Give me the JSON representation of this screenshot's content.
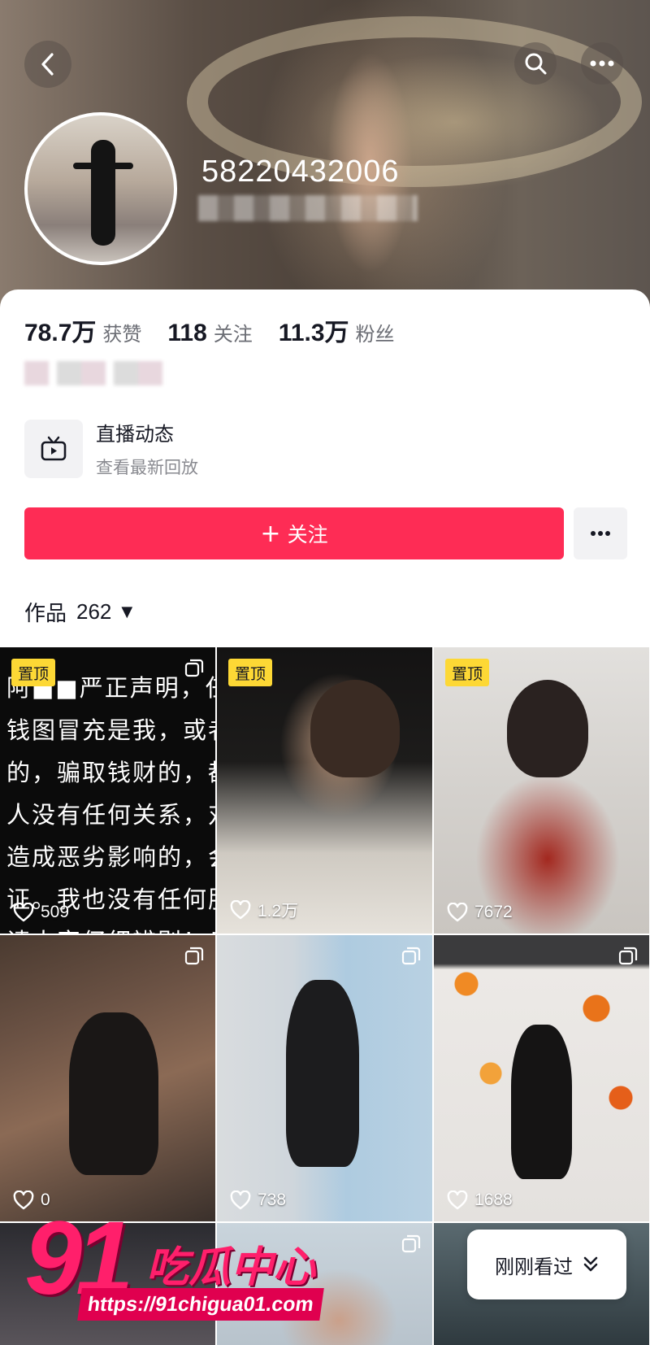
{
  "header": {
    "user_id": "58220432006"
  },
  "stats": [
    {
      "value": "78.7万",
      "label": "获赞"
    },
    {
      "value": "118",
      "label": "关注"
    },
    {
      "value": "11.3万",
      "label": "粉丝"
    }
  ],
  "live": {
    "title": "直播动态",
    "subtitle": "查看最新回放"
  },
  "follow_button": {
    "plus": "+",
    "label": "关注"
  },
  "works_tab": {
    "label": "作品",
    "count": "262",
    "caret": "▼"
  },
  "grid": [
    {
      "pinned_label": "置顶",
      "likes": "509",
      "text": "阿■■严正声明，任\n钱图冒充是我，或者\n的，骗取钱财的，都\n人没有任何关系，对\n造成恶劣影响的，会\n证。我也没有任何服\n请大家仔细辨别！！"
    },
    {
      "pinned_label": "置顶",
      "likes": "1.2万"
    },
    {
      "pinned_label": "置顶",
      "likes": "7672"
    },
    {
      "likes": "0"
    },
    {
      "likes": "738"
    },
    {
      "likes": "1688"
    }
  ],
  "watermark": {
    "number": "91",
    "name": "吃瓜中心",
    "url": "https://91chigua01.com"
  },
  "recent_button": {
    "label": "刚刚看过"
  },
  "colors": {
    "primary": "#fe2c55",
    "pin": "#fdd835"
  }
}
